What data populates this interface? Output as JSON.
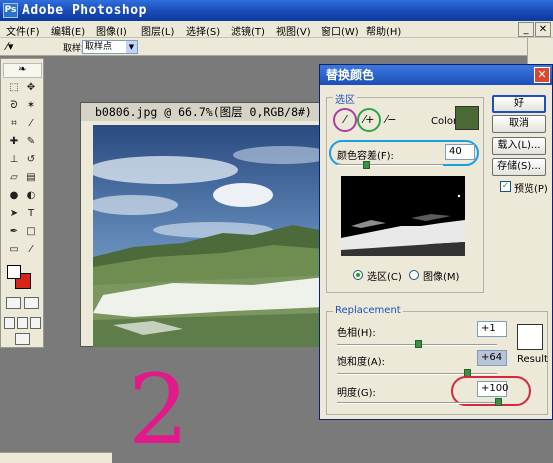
{
  "app": {
    "title": "Adobe Photoshop",
    "icon_letters": "Ps"
  },
  "menu": {
    "items": [
      "文件(F)",
      "编辑(E)",
      "图像(I)",
      "图层(L)",
      "选择(S)",
      "滤镜(T)",
      "视图(V)",
      "窗口(W)",
      "帮助(H)"
    ],
    "min_glyph": "_",
    "close_glyph": "✕"
  },
  "options_bar": {
    "sample_label": "取样大小:",
    "sample_value": "取样点"
  },
  "document": {
    "title": "b0806.jpg @ 66.7%(图层 0,RGB/8#)"
  },
  "dialog": {
    "title": "替换颜色",
    "close_glyph": "✕",
    "selection_group": "选区",
    "color_label": "Color:",
    "color_swatch": "#4a6a33",
    "fuzziness_label": "颜色容差(F):",
    "fuzziness_value": "40",
    "radio_selection": "选区(C)",
    "radio_image": "图像(M)",
    "replacement_group": "Replacement",
    "hue_label": "色相(H):",
    "hue_value": "+1",
    "saturation_label": "饱和度(A):",
    "saturation_value": "+64",
    "lightness_label": "明度(G):",
    "lightness_value": "+100",
    "result_label": "Result",
    "result_color": "#ffffff",
    "buttons": {
      "ok": "好",
      "cancel": "取消",
      "load": "载入(L)...",
      "save": "存储(S)..."
    },
    "preview_label": "预览(P)",
    "preview_checked": true
  },
  "annotation": {
    "big_number": "2",
    "color": "#e2198a"
  },
  "colors": {
    "foreground": "#ffffff",
    "background": "#d8241a",
    "highlight_ring": "#1aa0e0",
    "lightness_ring": "#d6283d"
  }
}
